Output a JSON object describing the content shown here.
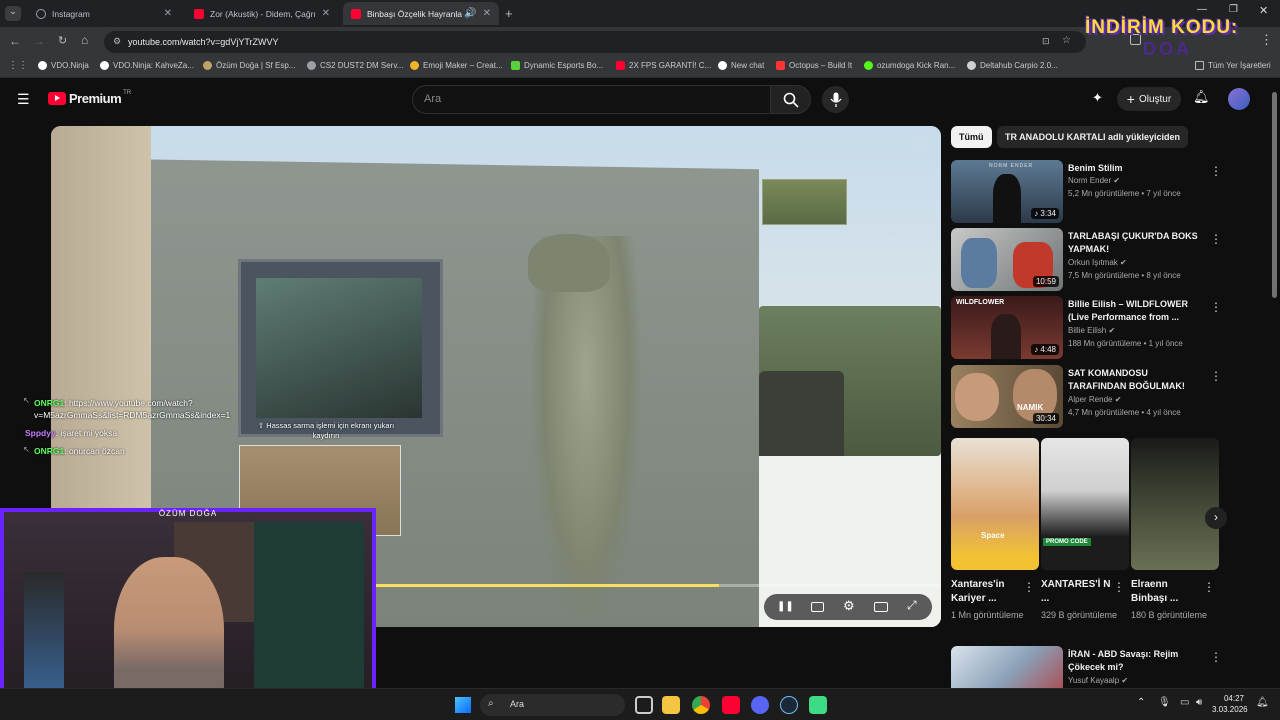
{
  "browser": {
    "tabs": [
      {
        "title": "Instagram",
        "color": "#9aa0a6",
        "active": false
      },
      {
        "title": "Zor (Akustik) - Didem, Çağrı Er",
        "color": "#ff0033",
        "active": false
      },
      {
        "title": "Binbaşı Özçelik Hayranları İ",
        "color": "#ff0033",
        "active": true
      }
    ],
    "url": "youtube.com/watch?v=gdVjYTrZWVY",
    "bookmarks": [
      {
        "label": "VDO.Ninja",
        "color": "#ffffff"
      },
      {
        "label": "VDO.Ninja: KahveZa...",
        "color": "#ffffff"
      },
      {
        "label": "Özüm Doğa | Sf Esp...",
        "color": "#bfa46a"
      },
      {
        "label": "CS2 DUST2 DM Serv...",
        "color": "#9aa0a6"
      },
      {
        "label": "Emoji Maker – Creat...",
        "color": "#f0b429"
      },
      {
        "label": "Dynamic Esports Bo...",
        "color": "#58d23a"
      },
      {
        "label": "2X FPS GARANTİ! C...",
        "color": "#ff0033"
      },
      {
        "label": "New chat",
        "color": "#ffffff"
      },
      {
        "label": "Octopus – Build It",
        "color": "#ff3333"
      },
      {
        "label": "ozumdoga Kick Ran...",
        "color": "#53fc18"
      },
      {
        "label": "Deltahub Carpio 2.0...",
        "color": "#cfcfcf"
      }
    ],
    "all_bookmarks": "Tüm Yer İşaretleri",
    "overlay_promo_line1": "İNDİRİM KODU:",
    "overlay_promo_line2": "DOA"
  },
  "youtube": {
    "logo": "Premium",
    "logo_sup": "TR",
    "search_placeholder": "Ara",
    "create_label": "Oluştur",
    "filter_chips": [
      "Tümü",
      "TR ANADOLU KARTALI adlı yükleyiciden"
    ],
    "player": {
      "info_icon": "ⓘ",
      "caption_notice": "Hassas sarma işlemi için ekranı yukarı kaydırın",
      "progress_fraction": 0.75
    },
    "recommendations": [
      {
        "title": "Benim Stilim",
        "channel": "Norm Ender",
        "meta": "5,2 Mn görüntüleme • 7 yıl önce",
        "duration": "3:34",
        "thumb": "#3a5066"
      },
      {
        "title": "TARLABAŞI ÇUKUR'DA BOKS YAPMAK!",
        "channel": "Orkun Işıtmak",
        "meta": "7,5 Mn görüntüleme • 8 yıl önce",
        "duration": "10:59",
        "thumb": "#8a8f92"
      },
      {
        "title": "Billie Eilish – WILDFLOWER (Live Performance from ...",
        "channel": "Billie Eilish",
        "meta": "188 Mn görüntüleme • 1 yıl önce",
        "duration": "4:48",
        "thumb": "#5a2b2b"
      },
      {
        "title": "SAT KOMANDOSU TARAFINDAN BOĞULMAK! Yaşayan Efsanel...",
        "channel": "Alper Rende",
        "meta": "4,7 Mn görüntüleme • 4 yıl önce",
        "duration": "30:34",
        "thumb": "#6b5a45"
      },
      {
        "title": "İRAN - ABD Savaşı: Rejim Çökecek mi?",
        "channel": "Yusuf Kayaalp",
        "meta": "",
        "duration": "",
        "thumb": "#8aa0b8"
      }
    ],
    "thumb_labels": {
      "norm": "NORM ENDER",
      "wild": "WILDFLOWER",
      "namik": "NAMIK"
    },
    "shorts": [
      {
        "title": "Xantares'in Kariyer ...",
        "views": "1 Mn görüntüleme",
        "badge": "Space",
        "bg": "#d9a066"
      },
      {
        "title": "XANTARES'İ N ...",
        "views": "329 B görüntüleme",
        "badge": "PROMO CODE",
        "bg": "#1c1c1c"
      },
      {
        "title": "Elraenn Binbaşı ...",
        "views": "180 B görüntüleme",
        "badge": "",
        "bg": "#2a3025"
      }
    ]
  },
  "stream_overlay": {
    "chat": [
      {
        "user": "ONRG1",
        "user_color": "#5cff5c",
        "text": ": https://www.youtube.com/watch?v=M5azrGmmaSs&list=RDM5azrGmmaSs&index=1"
      },
      {
        "user": "Sppdyy",
        "user_color": "#c77dff",
        "text": ": işaret mi yoksa"
      },
      {
        "user": "ONRG1",
        "user_color": "#5cff5c",
        "text": ": onurcan özcan"
      }
    ],
    "webcam_name": "ÖZÜM DOĞA",
    "frame_color": "#6a22ff"
  },
  "taskbar": {
    "search_label": "Ara",
    "time": "04:27",
    "date": "3.03.2026"
  }
}
